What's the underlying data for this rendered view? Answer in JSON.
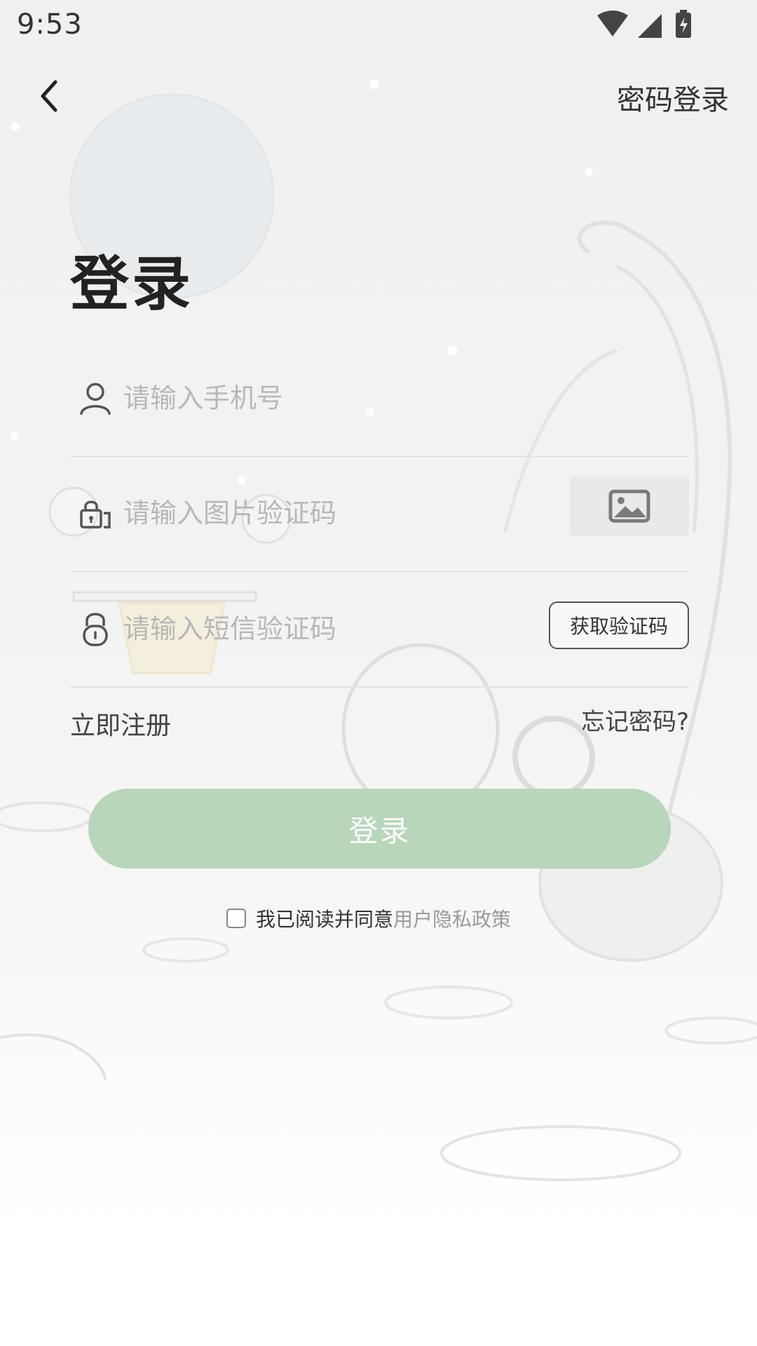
{
  "status_bar": {
    "time": "9:53"
  },
  "header": {
    "password_login_label": "密码登录"
  },
  "title": "登录",
  "form": {
    "phone": {
      "placeholder": "请输入手机号",
      "value": ""
    },
    "image_captcha": {
      "placeholder": "请输入图片验证码",
      "value": ""
    },
    "sms_code": {
      "placeholder": "请输入短信验证码",
      "value": "",
      "get_code_label": "获取验证码"
    }
  },
  "links": {
    "register": "立即注册",
    "forgot_password": "忘记密码?"
  },
  "login_button": {
    "label": "登录",
    "color": "#b7d6ba"
  },
  "agreement": {
    "checked": false,
    "text": "我已阅读并同意",
    "policy_link": "用户隐私政策"
  },
  "icons": {
    "back": "chevron-left-icon",
    "phone": "user-icon",
    "image_captcha": "shield-lock-icon",
    "sms_code": "padlock-icon",
    "captcha_placeholder": "image-icon"
  }
}
